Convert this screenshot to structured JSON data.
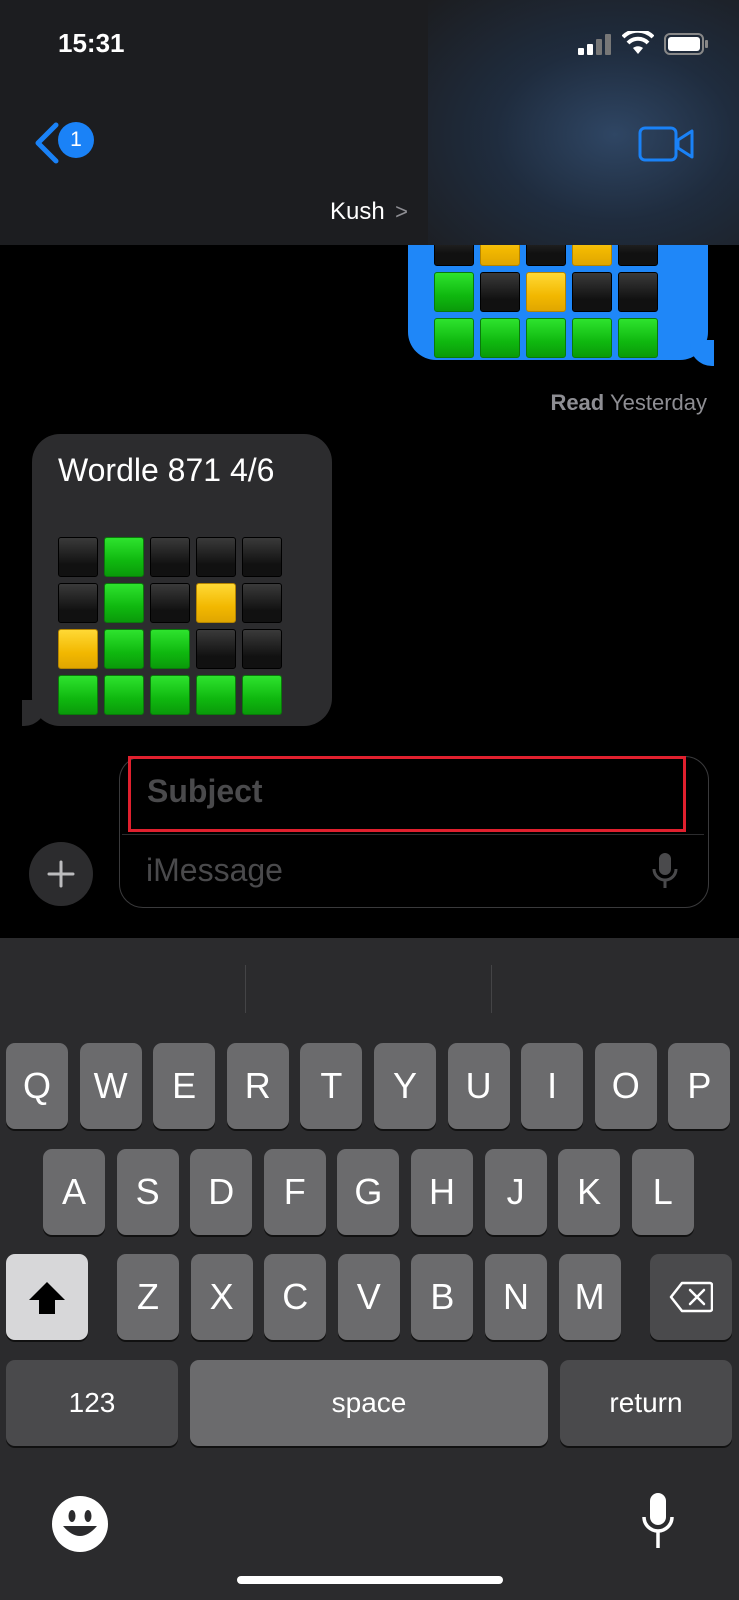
{
  "status_bar": {
    "time": "15:31"
  },
  "header": {
    "back_badge": "1",
    "contact": "Kush",
    "contact_chevron": ">",
    "video_icon": "video-camera-icon"
  },
  "messages": {
    "sent_grid": [
      [
        "black",
        "yellow",
        "black",
        "yellow",
        "black"
      ],
      [
        "green",
        "black",
        "yellow",
        "black",
        "black"
      ],
      [
        "green",
        "green",
        "green",
        "green",
        "green"
      ]
    ],
    "read_label": "Read",
    "read_time": "Yesterday",
    "received_text": "Wordle 871 4/6",
    "received_grid": [
      [
        "black",
        "green",
        "black",
        "black",
        "black"
      ],
      [
        "black",
        "green",
        "black",
        "yellow",
        "black"
      ],
      [
        "yellow",
        "green",
        "green",
        "black",
        "black"
      ],
      [
        "green",
        "green",
        "green",
        "green",
        "green"
      ]
    ]
  },
  "compose": {
    "subject_placeholder": "Subject",
    "message_placeholder": "iMessage",
    "plus_label": "+"
  },
  "keyboard": {
    "row1": [
      "Q",
      "W",
      "E",
      "R",
      "T",
      "Y",
      "U",
      "I",
      "O",
      "P"
    ],
    "row2": [
      "A",
      "S",
      "D",
      "F",
      "G",
      "H",
      "J",
      "K",
      "L"
    ],
    "row3": [
      "Z",
      "X",
      "C",
      "V",
      "B",
      "N",
      "M"
    ],
    "numbers_label": "123",
    "space_label": "space",
    "return_label": "return"
  },
  "colors": {
    "accent": "#1a82f7",
    "green": "#12c012",
    "yellow": "#f5c000",
    "highlight": "#e0202e"
  }
}
